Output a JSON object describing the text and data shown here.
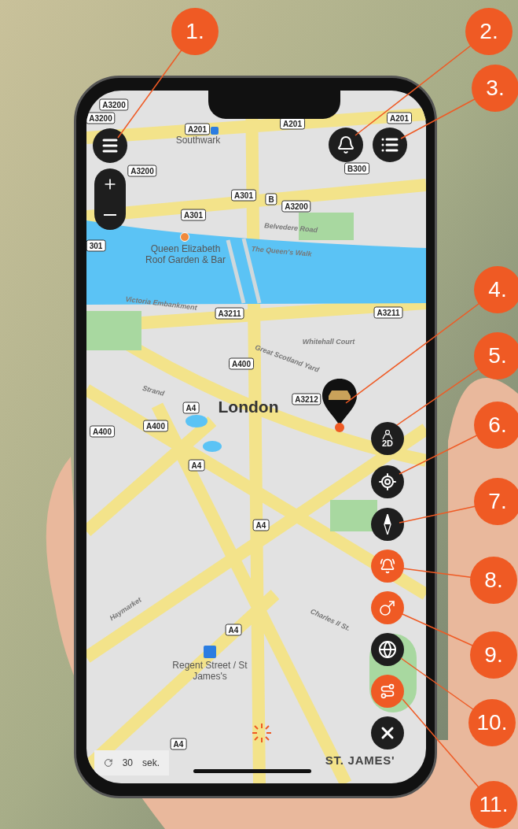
{
  "top_buttons": [
    {
      "kind": "menu"
    },
    {
      "kind": "notifications"
    },
    {
      "kind": "list"
    }
  ],
  "zoom_buttons": [
    {
      "kind": "zoom_in"
    },
    {
      "kind": "zoom_out"
    }
  ],
  "side_buttons": [
    {
      "kind": "view_mode",
      "label": "2D",
      "on": false
    },
    {
      "kind": "locate",
      "on": false
    },
    {
      "kind": "compass",
      "on": false
    },
    {
      "kind": "alarm",
      "on": true
    },
    {
      "kind": "gender",
      "on": true
    },
    {
      "kind": "globe",
      "on": false
    },
    {
      "kind": "route",
      "on": true
    },
    {
      "kind": "close",
      "on": false
    }
  ],
  "map": {
    "labels": [
      {
        "kind": "road",
        "text": "A3200"
      },
      {
        "kind": "road",
        "text": "A201"
      },
      {
        "kind": "road",
        "text": "A201"
      },
      {
        "kind": "road",
        "text": "A3200"
      },
      {
        "kind": "road",
        "text": "A201"
      },
      {
        "kind": "place",
        "text": "Southwark"
      },
      {
        "kind": "road",
        "text": "B300"
      },
      {
        "kind": "road",
        "text": "A3200"
      },
      {
        "kind": "road",
        "text": "A301"
      },
      {
        "kind": "road",
        "text": "B"
      },
      {
        "kind": "road",
        "text": "A3200"
      },
      {
        "kind": "road",
        "text": "A301"
      },
      {
        "kind": "street",
        "text": "Belvedere Road"
      },
      {
        "kind": "road",
        "text": "301"
      },
      {
        "kind": "street",
        "text": "The Queen's Walk"
      },
      {
        "kind": "place",
        "text": "Queen Elizabeth Roof Garden & Bar"
      },
      {
        "kind": "street",
        "text": "Victoria Embankment"
      },
      {
        "kind": "road",
        "text": "A3211"
      },
      {
        "kind": "road",
        "text": "A3211"
      },
      {
        "kind": "street",
        "text": "Whitehall Court"
      },
      {
        "kind": "street",
        "text": "Great Scotland Yard"
      },
      {
        "kind": "road",
        "text": "A400"
      },
      {
        "kind": "street",
        "text": "Strand"
      },
      {
        "kind": "road",
        "text": "A3212"
      },
      {
        "kind": "road",
        "text": "A4"
      },
      {
        "kind": "city",
        "text": "London"
      },
      {
        "kind": "road",
        "text": "A400"
      },
      {
        "kind": "road",
        "text": "A400"
      },
      {
        "kind": "road",
        "text": "A4"
      },
      {
        "kind": "road",
        "text": "A4"
      },
      {
        "kind": "street",
        "text": "Haymarket"
      },
      {
        "kind": "street",
        "text": "Charles II St."
      },
      {
        "kind": "road",
        "text": "A4"
      },
      {
        "kind": "place",
        "text": "Regent Street / St James's"
      },
      {
        "kind": "road",
        "text": "A4"
      },
      {
        "kind": "district",
        "text": "ST. JAMES'"
      }
    ]
  },
  "refresh": {
    "value": "30",
    "unit": "sek."
  },
  "callouts": [
    "1.",
    "2.",
    "3.",
    "4.",
    "5.",
    "6.",
    "7.",
    "8.",
    "9.",
    "10.",
    "11."
  ]
}
